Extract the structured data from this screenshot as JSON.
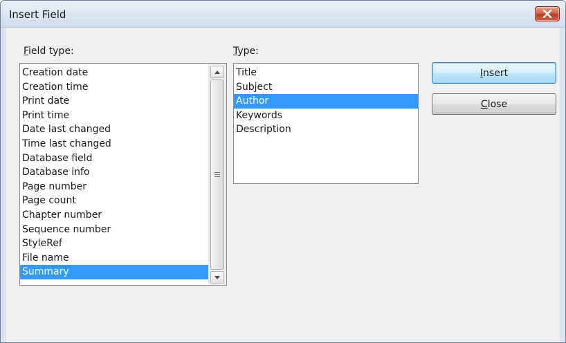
{
  "window": {
    "title": "Insert Field",
    "close_icon": "close-x-icon",
    "close_color": "#c7432b"
  },
  "field_type": {
    "label_mnemonic": "F",
    "label_rest": "ield type:",
    "items": [
      "Creation date",
      "Creation time",
      "Print date",
      "Print time",
      "Date last changed",
      "Time last changed",
      "Database field",
      "Database info",
      "Page number",
      "Page count",
      "Chapter number",
      "Sequence number",
      "StyleRef",
      "File name",
      "Summary"
    ],
    "selected": "Summary"
  },
  "type": {
    "label_mnemonic": "T",
    "label_rest": "ype:",
    "items": [
      "Title",
      "Subject",
      "Author",
      "Keywords",
      "Description"
    ],
    "selected": "Author"
  },
  "buttons": {
    "insert_mnemonic": "I",
    "insert_rest": "nsert",
    "close_mnemonic": "C",
    "close_rest": "lose"
  },
  "colors": {
    "selection": "#3399ff",
    "dialog_bg": "#f0f0f0"
  }
}
